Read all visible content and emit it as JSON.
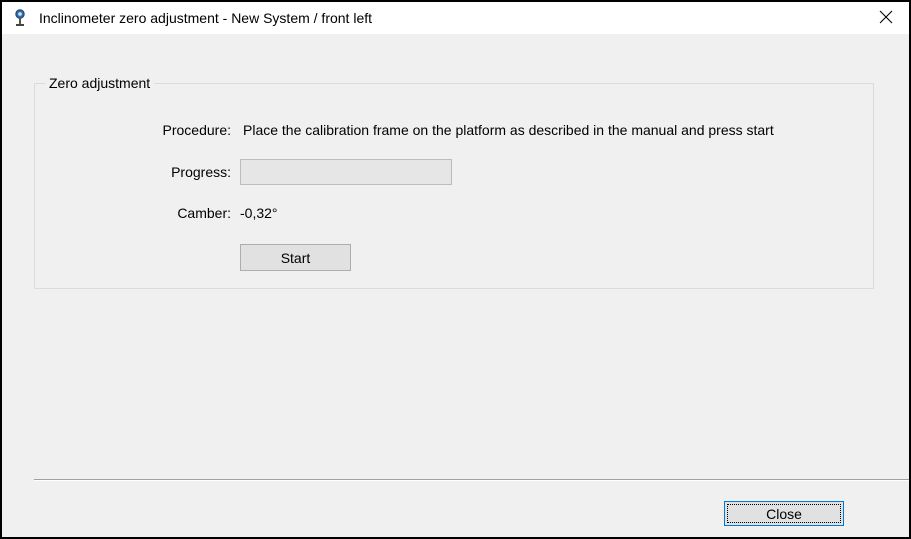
{
  "window": {
    "title": "Inclinometer zero adjustment - New System / front left",
    "close_glyph": "✕",
    "icon": "inclinometer-app-icon"
  },
  "group": {
    "title": "Zero adjustment"
  },
  "procedure": {
    "label": "Procedure:",
    "text": "Place the calibration frame on the platform as described in the manual and press start"
  },
  "progress": {
    "label": "Progress:",
    "value": 0
  },
  "camber": {
    "label": "Camber:",
    "value": "-0,32°"
  },
  "buttons": {
    "start_label": "Start",
    "close_label": "Close"
  },
  "colors": {
    "window_background": "#f0f0f0",
    "titlebar_background": "#ffffff",
    "focus_border": "#0078d7",
    "progress_fill": "#06b025"
  }
}
